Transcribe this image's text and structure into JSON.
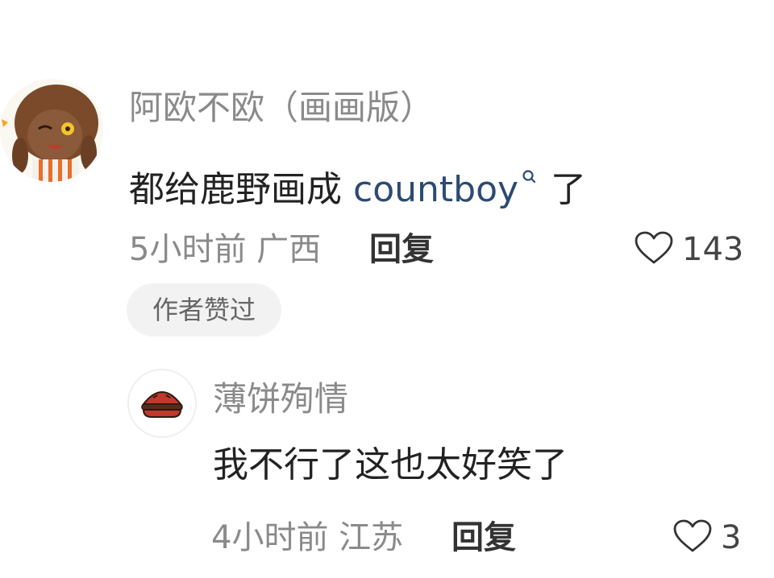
{
  "comments": [
    {
      "username": "阿欧不欧（画画版）",
      "text_before": "都给鹿野画成 ",
      "mention": "countboy",
      "text_after": "了",
      "time": "5小时前",
      "location": "广西",
      "reply_label": "回复",
      "likes": "143",
      "badge": "作者赞过"
    }
  ],
  "reply": {
    "username": "薄饼殉情",
    "text": "我不行了这也太好笑了",
    "time": "4小时前",
    "location": "江苏",
    "reply_label": "回复",
    "likes": "3"
  },
  "colors": {
    "secondary_text": "#8a8a8a",
    "mention": "#2c4a73",
    "badge_bg": "#f2f2f2"
  },
  "icons": [
    "heart-outline-icon",
    "search-icon"
  ]
}
